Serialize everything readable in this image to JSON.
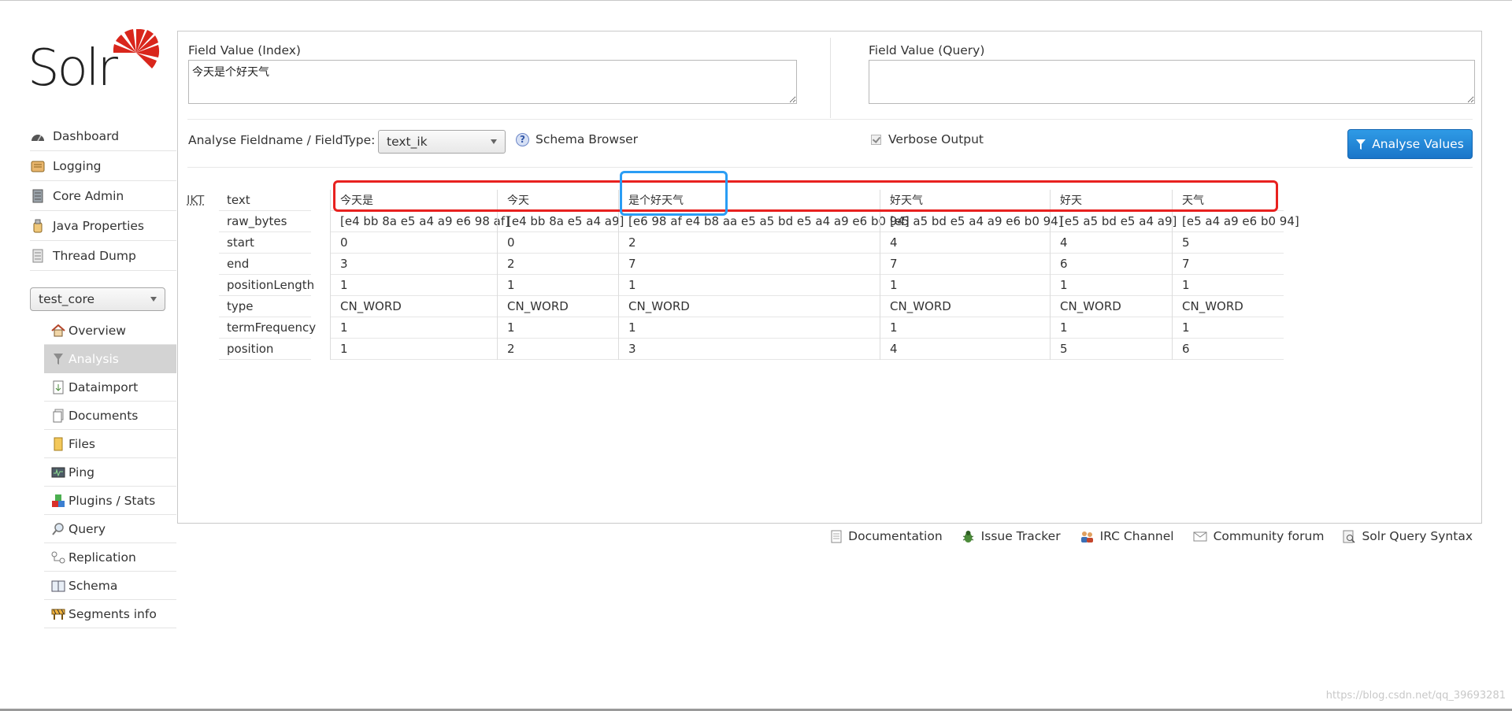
{
  "logo": {
    "text": "Solr"
  },
  "nav": [
    {
      "label": "Dashboard",
      "icon": "dashboard-icon"
    },
    {
      "label": "Logging",
      "icon": "logging-icon"
    },
    {
      "label": "Core Admin",
      "icon": "core-admin-icon"
    },
    {
      "label": "Java Properties",
      "icon": "java-properties-icon"
    },
    {
      "label": "Thread Dump",
      "icon": "thread-dump-icon"
    }
  ],
  "core_selector": {
    "value": "test_core"
  },
  "core_nav": [
    {
      "label": "Overview",
      "icon": "overview-icon"
    },
    {
      "label": "Analysis",
      "icon": "analysis-icon",
      "active": true
    },
    {
      "label": "Dataimport",
      "icon": "dataimport-icon"
    },
    {
      "label": "Documents",
      "icon": "documents-icon"
    },
    {
      "label": "Files",
      "icon": "files-icon"
    },
    {
      "label": "Ping",
      "icon": "ping-icon"
    },
    {
      "label": "Plugins / Stats",
      "icon": "plugins-icon"
    },
    {
      "label": "Query",
      "icon": "query-icon"
    },
    {
      "label": "Replication",
      "icon": "replication-icon"
    },
    {
      "label": "Schema",
      "icon": "schema-icon"
    },
    {
      "label": "Segments info",
      "icon": "segments-icon"
    }
  ],
  "analysis": {
    "index_label": "Field Value (Index)",
    "index_value": "今天是个好天气",
    "query_label": "Field Value (Query)",
    "query_value": "",
    "fieldtype_label": "Analyse Fieldname / FieldType:",
    "fieldtype_value": "text_ik",
    "schema_browser": "Schema Browser",
    "verbose_label": "Verbose Output",
    "verbose_checked": true,
    "analyse_button": "Analyse Values",
    "analyzer_abbr": "IKT",
    "row_keys": [
      "text",
      "raw_bytes",
      "start",
      "end",
      "positionLength",
      "type",
      "termFrequency",
      "position"
    ],
    "tokens": [
      {
        "text": "今天是",
        "raw_bytes": "[e4 bb 8a e5 a4 a9 e6 98 af]",
        "start": "0",
        "end": "3",
        "positionLength": "1",
        "type": "CN_WORD",
        "termFrequency": "1",
        "position": "1"
      },
      {
        "text": "今天",
        "raw_bytes": "[e4 bb 8a e5 a4 a9]",
        "start": "0",
        "end": "2",
        "positionLength": "1",
        "type": "CN_WORD",
        "termFrequency": "1",
        "position": "2"
      },
      {
        "text": "是个好天气",
        "raw_bytes": "[e6 98 af e4 b8 aa e5 a5 bd e5 a4 a9 e6 b0 94]",
        "start": "2",
        "end": "7",
        "positionLength": "1",
        "type": "CN_WORD",
        "termFrequency": "1",
        "position": "3"
      },
      {
        "text": "好天气",
        "raw_bytes": "[e5 a5 bd e5 a4 a9 e6 b0 94]",
        "start": "4",
        "end": "7",
        "positionLength": "1",
        "type": "CN_WORD",
        "termFrequency": "1",
        "position": "4"
      },
      {
        "text": "好天",
        "raw_bytes": "[e5 a5 bd e5 a4 a9]",
        "start": "4",
        "end": "6",
        "positionLength": "1",
        "type": "CN_WORD",
        "termFrequency": "1",
        "position": "5"
      },
      {
        "text": "天气",
        "raw_bytes": "[e5 a4 a9 e6 b0 94]",
        "start": "5",
        "end": "7",
        "positionLength": "1",
        "type": "CN_WORD",
        "termFrequency": "1",
        "position": "6"
      }
    ]
  },
  "footer": [
    {
      "label": "Documentation",
      "icon": "documentation-icon"
    },
    {
      "label": "Issue Tracker",
      "icon": "bug-icon"
    },
    {
      "label": "IRC Channel",
      "icon": "irc-icon"
    },
    {
      "label": "Community forum",
      "icon": "mail-icon"
    },
    {
      "label": "Solr Query Syntax",
      "icon": "query-syntax-icon"
    }
  ],
  "watermark": "https://blog.csdn.net/qq_39693281",
  "colors": {
    "accent_blue": "#1a75c9",
    "highlight_red": "#e8211f",
    "highlight_blue": "#2a9df4",
    "logo_red": "#d9261c",
    "active_nav_bg": "#d3d3d3"
  }
}
